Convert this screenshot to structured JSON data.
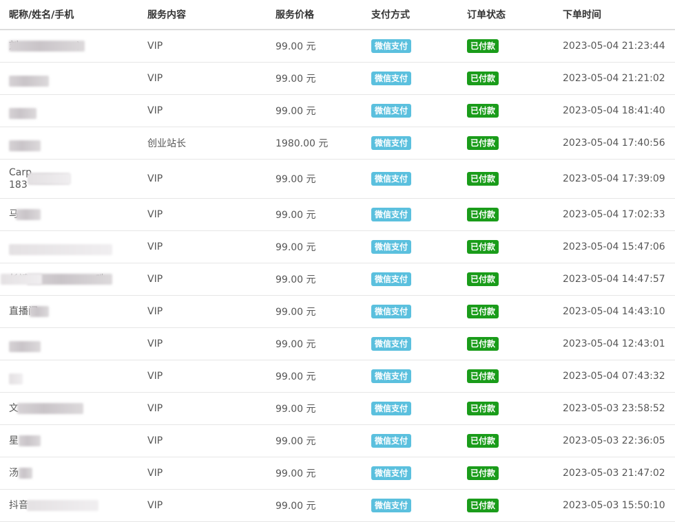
{
  "columns": [
    "昵称/姓名/手机",
    "服务内容",
    "服务价格",
    "支付方式",
    "订单状态",
    "下单时间"
  ],
  "colors": {
    "pay_badge": "#5bc0de",
    "status_badge": "#1a9c1a"
  },
  "rows": [
    {
      "name": "刘　　　　　　)",
      "service": "VIP",
      "price": "99.00 元",
      "payment": "微信支付",
      "status": "已付款",
      "time": "2023-05-04 21:23:44"
    },
    {
      "name": "",
      "service": "VIP",
      "price": "99.00 元",
      "payment": "微信支付",
      "status": "已付款",
      "time": "2023-05-04 21:21:02"
    },
    {
      "name": "",
      "service": "VIP",
      "price": "99.00 元",
      "payment": "微信支付",
      "status": "已付款",
      "time": "2023-05-04 18:41:40"
    },
    {
      "name": "",
      "service": "创业站长",
      "price": "1980.00 元",
      "payment": "微信支付",
      "status": "已付款",
      "time": "2023-05-04 17:40:56"
    },
    {
      "name": "Carp\n183",
      "service": "VIP",
      "price": "99.00 元",
      "payment": "微信支付",
      "status": "已付款",
      "time": "2023-05-04 17:39:09"
    },
    {
      "name": "马",
      "service": "VIP",
      "price": "99.00 元",
      "payment": "微信支付",
      "status": "已付款",
      "time": "2023-05-04 17:02:33"
    },
    {
      "name": "",
      "service": "VIP",
      "price": "99.00 元",
      "payment": "微信支付",
      "status": "已付款",
      "time": "2023-05-04 15:47:06"
    },
    {
      "name": "长斌　　　　　　　吽",
      "service": "VIP",
      "price": "99.00 元",
      "payment": "微信支付",
      "status": "已付款",
      "time": "2023-05-04 14:47:57"
    },
    {
      "name": "直播间",
      "service": "VIP",
      "price": "99.00 元",
      "payment": "微信支付",
      "status": "已付款",
      "time": "2023-05-04 14:43:10"
    },
    {
      "name": "",
      "service": "VIP",
      "price": "99.00 元",
      "payment": "微信支付",
      "status": "已付款",
      "time": "2023-05-04 12:43:01"
    },
    {
      "name": "",
      "service": "VIP",
      "price": "99.00 元",
      "payment": "微信支付",
      "status": "已付款",
      "time": "2023-05-04 07:43:32"
    },
    {
      "name": "文",
      "service": "VIP",
      "price": "99.00 元",
      "payment": "微信支付",
      "status": "已付款",
      "time": "2023-05-03 23:58:52"
    },
    {
      "name": "星",
      "service": "VIP",
      "price": "99.00 元",
      "payment": "微信支付",
      "status": "已付款",
      "time": "2023-05-03 22:36:05"
    },
    {
      "name": "汤",
      "service": "VIP",
      "price": "99.00 元",
      "payment": "微信支付",
      "status": "已付款",
      "time": "2023-05-03 21:47:02"
    },
    {
      "name": "抖音",
      "service": "VIP",
      "price": "99.00 元",
      "payment": "微信支付",
      "status": "已付款",
      "time": "2023-05-03 15:50:10"
    }
  ]
}
